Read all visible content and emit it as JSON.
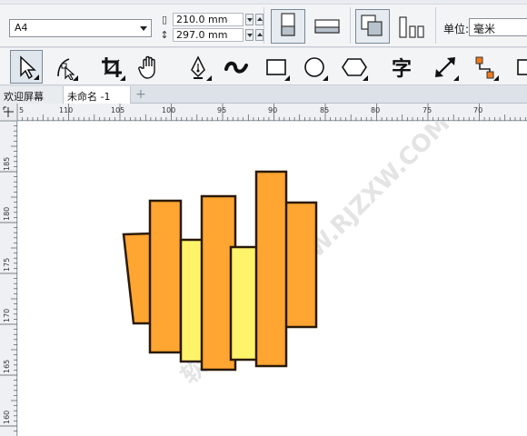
{
  "property_bar": {
    "paper_size": "A4",
    "width_value": "210.0 mm",
    "height_value": "297.0 mm",
    "unit_label": "单位:",
    "unit_value": "毫米"
  },
  "toolbox": {
    "tools": [
      {
        "name": "pick-tool",
        "icon": "arrow-cursor-icon",
        "active": true
      },
      {
        "name": "shape-tool",
        "icon": "shape-node-icon"
      },
      {
        "name": "crop-tool",
        "icon": "crop-icon"
      },
      {
        "name": "pan-tool",
        "icon": "hand-icon"
      },
      {
        "name": "pen-tool",
        "icon": "pen-nib-icon"
      },
      {
        "name": "artistic-media-tool",
        "icon": "curve-stroke-icon"
      },
      {
        "name": "rectangle-tool",
        "icon": "rectangle-icon"
      },
      {
        "name": "ellipse-tool",
        "icon": "ellipse-icon"
      },
      {
        "name": "polygon-tool",
        "icon": "hexagon-icon"
      },
      {
        "name": "text-tool",
        "icon": "text-glyph-icon",
        "glyph": "字"
      },
      {
        "name": "dimension-tool",
        "icon": "diagonal-arrow-icon"
      },
      {
        "name": "connector-tool",
        "icon": "connector-icon"
      },
      {
        "name": "interactive-tool",
        "icon": "drop-shadow-icon"
      }
    ]
  },
  "tabs": {
    "welcome": "欢迎屏幕",
    "document": "未命名 -1",
    "add": "+"
  },
  "hruler_labels": [
    "5",
    "110",
    "105",
    "100",
    "95",
    "90",
    "85",
    "80",
    "75",
    "70"
  ],
  "vruler_labels": [
    "185",
    "180",
    "175",
    "170",
    "165",
    "160"
  ],
  "watermark": "软件自学网 WWW.RJZXW.COM",
  "colors": {
    "orange": "#FFA531",
    "yellow": "#FFF36A",
    "stroke": "#2a1a08",
    "selection": "#7a8796"
  }
}
